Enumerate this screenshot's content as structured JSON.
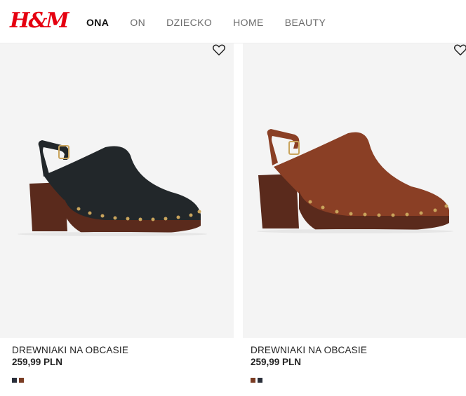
{
  "header": {
    "logo_text": "H&M",
    "nav": [
      {
        "label": "ONA",
        "active": true
      },
      {
        "label": "ON",
        "active": false
      },
      {
        "label": "DZIECKO",
        "active": false
      },
      {
        "label": "HOME",
        "active": false
      },
      {
        "label": "BEAUTY",
        "active": false
      }
    ]
  },
  "products": [
    {
      "name": "DREWNIAKI NA OBCASIE",
      "price": "259,99 PLN",
      "shoe_color": "#22272a",
      "favorite_icon": "heart-outline-icon",
      "swatches": [
        "#2a2f3a",
        "#7a3c23"
      ]
    },
    {
      "name": "DREWNIAKI NA OBCASIE",
      "price": "259,99 PLN",
      "shoe_color": "#8a3f25",
      "favorite_icon": "heart-outline-icon",
      "swatches": [
        "#7a3c23",
        "#2a2f3a"
      ]
    }
  ],
  "colors": {
    "brand": "#e50010",
    "heel_wood": "#5a2a1c",
    "studs": "#c9a45c"
  }
}
